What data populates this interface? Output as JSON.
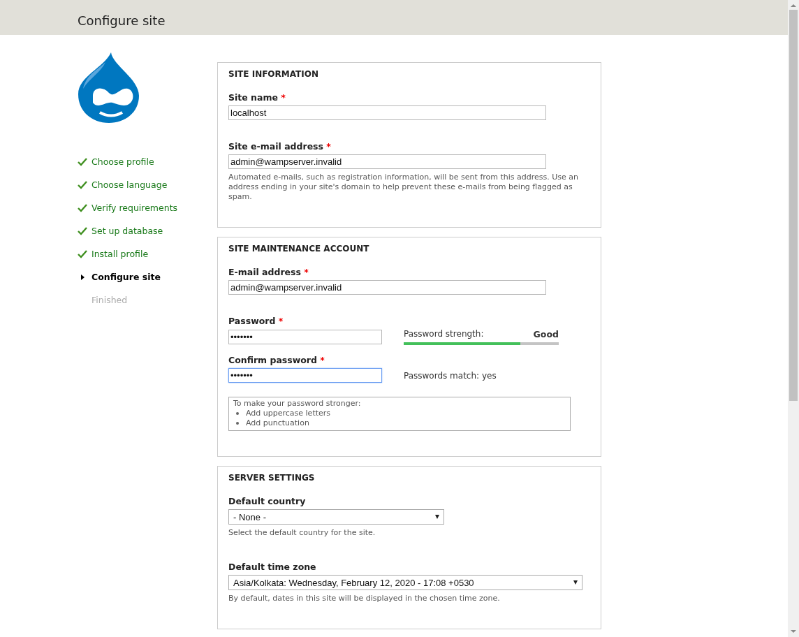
{
  "header": {
    "title": "Configure site"
  },
  "steps": [
    {
      "label": "Choose profile",
      "done": true,
      "selected": false
    },
    {
      "label": "Choose language",
      "done": true,
      "selected": false
    },
    {
      "label": "Verify requirements",
      "done": true,
      "selected": false
    },
    {
      "label": "Set up database",
      "done": true,
      "selected": false
    },
    {
      "label": "Install profile",
      "done": true,
      "selected": false
    },
    {
      "label": "Configure site",
      "done": false,
      "selected": true
    },
    {
      "label": "Finished",
      "done": false,
      "selected": false
    }
  ],
  "sections": [
    {
      "title": "SITE INFORMATION",
      "fields": [
        {
          "kind": "text",
          "label": "Site name",
          "marker": "*",
          "value": "localhost"
        },
        {
          "kind": "text",
          "label": "Site e-mail address",
          "marker": "*",
          "value": "admin@wampserver.invalid",
          "description": "Automated e-mails, such as registration information, will be sent from this address. Use an address ending in your site's domain to help prevent these e-mails from being flagged as spam."
        }
      ]
    },
    {
      "title": "SITE MAINTENANCE ACCOUNT",
      "fields": [
        {
          "kind": "text",
          "label": "E-mail address",
          "marker": "*",
          "value": "admin@wampserver.invalid"
        },
        {
          "kind": "password",
          "label": "Password",
          "marker": "*",
          "value": "•••••••",
          "focused": false,
          "strength": {
            "label": "Password strength:",
            "rating": "Good",
            "level": 0.75
          }
        },
        {
          "kind": "password",
          "label": "Confirm password",
          "marker": "*",
          "value": "•••••••",
          "focused": true,
          "match": "Passwords match: yes"
        },
        {
          "kind": "hint",
          "title": "To make your password stronger:",
          "items": [
            "Add uppercase letters",
            "Add punctuation"
          ]
        }
      ]
    },
    {
      "title": "SERVER SETTINGS",
      "fields": [
        {
          "kind": "select",
          "wide": false,
          "label": "Default country",
          "value": "- None -",
          "description": "Select the default country for the site."
        },
        {
          "kind": "select",
          "wide": true,
          "label": "Default time zone",
          "value": "Asia/Kolkata: Wednesday, February 12, 2020 - 17:08 +0530",
          "description": "By default, dates in this site will be displayed in the chosen time zone."
        }
      ]
    }
  ]
}
